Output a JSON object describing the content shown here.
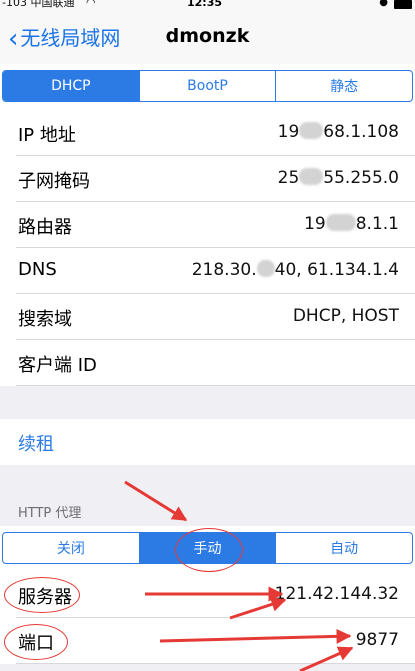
{
  "status_bar": {
    "carrier": "-103 中国联通",
    "time": "12:35"
  },
  "nav": {
    "back_label": "无线局域网",
    "title": "dmonzk"
  },
  "ip_mode_tabs": [
    "DHCP",
    "BootP",
    "静态"
  ],
  "ip_mode_selected": "DHCP",
  "rows": {
    "ip": {
      "label": "IP 地址",
      "value_a": "19",
      "value_b": "68.1.108"
    },
    "subnet": {
      "label": "子网掩码",
      "value_a": "25",
      "value_b": "55.255.0"
    },
    "router": {
      "label": "路由器",
      "value_a": "19",
      "value_b": "8.1.1"
    },
    "dns": {
      "label": "DNS",
      "value_a": "218.30.",
      "value_b": "40, 61.134.1.4"
    },
    "search_domain": {
      "label": "搜索域",
      "value": "DHCP, HOST"
    },
    "client_id": {
      "label": "客户端 ID",
      "value": ""
    }
  },
  "renew_label": "续租",
  "http_proxy": {
    "header": "HTTP 代理",
    "tabs": [
      "关闭",
      "手动",
      "自动"
    ],
    "selected": "手动",
    "server": {
      "label": "服务器",
      "value": "121.42.144.32"
    },
    "port": {
      "label": "端口",
      "value": "9877"
    }
  },
  "colors": {
    "accent": "#2c7be5",
    "annotation": "#e53935",
    "background": "#efeff4"
  }
}
